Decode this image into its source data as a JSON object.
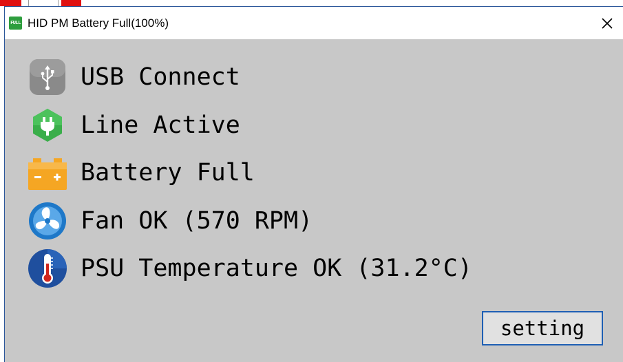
{
  "window": {
    "title": "HID PM Battery Full(100%)",
    "app_icon_text": "FULL",
    "close_symbol": "✕"
  },
  "status_items": [
    {
      "icon": "usb-icon",
      "label": "USB Connect"
    },
    {
      "icon": "plug-icon",
      "label": "Line Active"
    },
    {
      "icon": "battery-icon",
      "label": "Battery Full"
    },
    {
      "icon": "fan-icon",
      "label": "Fan OK (570 RPM)"
    },
    {
      "icon": "thermometer-icon",
      "label": "PSU Temperature OK (31.2°C)"
    }
  ],
  "buttons": {
    "setting_label": "setting"
  },
  "colors": {
    "content_bg": "#c8c8c8",
    "usb_icon": "#8a8a8a",
    "plug_icon": "#3aae4a",
    "battery_icon": "#f5a623",
    "fan_icon": "#1e78c8",
    "thermometer_bg": "#1f4f9e",
    "thermometer_mercury": "#d0271d",
    "button_border": "#1e5fb4"
  }
}
